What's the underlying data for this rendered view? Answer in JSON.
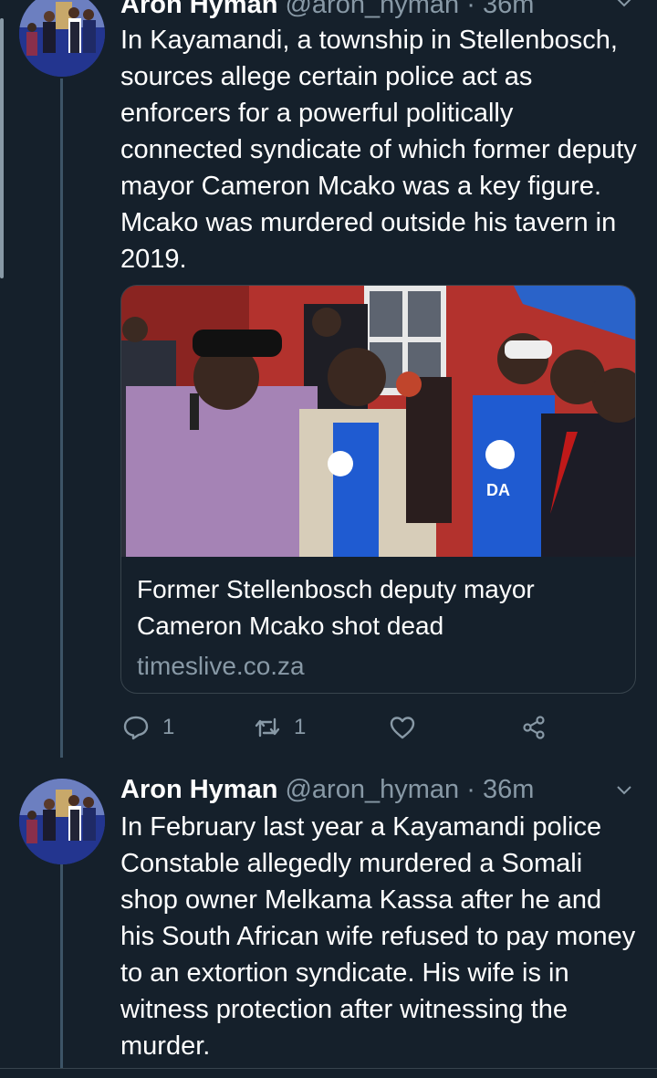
{
  "tweets": [
    {
      "name": "Aron Hyman",
      "handle": "@aron_hyman",
      "separator": "·",
      "time": "36m",
      "text": "In Kayamandi, a township in Stellenbosch, sources allege certain police act as enforcers for a powerful politically connected syndicate of which former deputy mayor Cameron Mcako was a key figure. Mcako was murdered outside his tavern in 2019.",
      "card": {
        "title": "Former Stellenbosch deputy mayor Cameron Mcako shot dead",
        "domain": "timeslive.co.za",
        "image_sign_text": "DA"
      },
      "actions": {
        "reply_count": "1",
        "retweet_count": "1",
        "like_count": "",
        "reply_icon": "reply-icon",
        "retweet_icon": "retweet-icon",
        "like_icon": "heart-icon",
        "share_icon": "share-icon"
      }
    },
    {
      "name": "Aron Hyman",
      "handle": "@aron_hyman",
      "separator": "·",
      "time": "36m",
      "text": "In February last year a Kayamandi police Constable allegedly murdered a Somali shop owner Melkama Kassa after he and his South African wife refused to pay money to an extortion syndicate. His wife is in witness protection after witnessing the murder."
    }
  ],
  "colors": {
    "background": "#15202b",
    "secondary_text": "#8899a6",
    "border": "#38444d",
    "thread_line": "#3d5466"
  }
}
